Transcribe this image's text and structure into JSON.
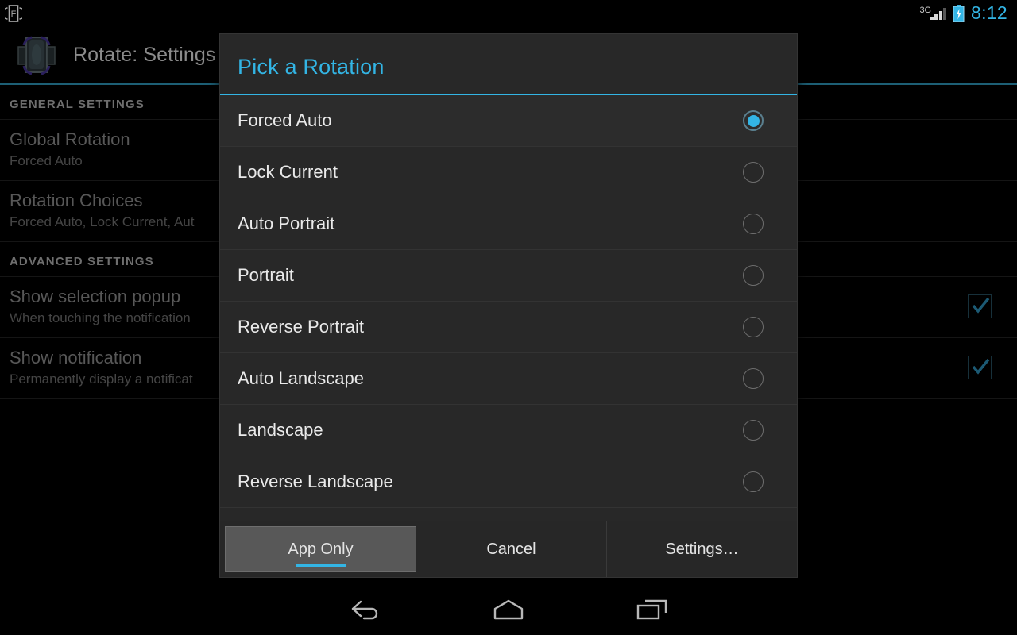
{
  "statusbar": {
    "notification_icon": "rotate-f-icon",
    "signal_label": "3G",
    "signal_icon": "signal-bars-icon",
    "battery_icon": "battery-charging-icon",
    "time": "8:12",
    "time_color": "#33b5e5"
  },
  "app": {
    "icon": "rotate-device-icon",
    "title": "Rotate: Settings",
    "accent_color": "#33b5e5",
    "sections": [
      {
        "header": "GENERAL SETTINGS",
        "rows": [
          {
            "title": "Global Rotation",
            "summary": "Forced Auto",
            "checkbox": null
          },
          {
            "title": "Rotation Choices",
            "summary": "Forced Auto, Lock Current, Aut",
            "checkbox": null
          }
        ]
      },
      {
        "header": "ADVANCED SETTINGS",
        "rows": [
          {
            "title": "Show selection popup",
            "summary": "When touching the notification",
            "checkbox": "checked"
          },
          {
            "title": "Show notification",
            "summary": "Permanently display a notificat",
            "checkbox": "checked"
          }
        ]
      }
    ]
  },
  "dialog": {
    "title": "Pick a Rotation",
    "title_color": "#33b5e5",
    "options": [
      {
        "label": "Forced Auto",
        "selected": true
      },
      {
        "label": "Lock Current",
        "selected": false
      },
      {
        "label": "Auto Portrait",
        "selected": false
      },
      {
        "label": "Portrait",
        "selected": false
      },
      {
        "label": "Reverse Portrait",
        "selected": false
      },
      {
        "label": "Auto Landscape",
        "selected": false
      },
      {
        "label": "Landscape",
        "selected": false
      },
      {
        "label": "Reverse Landscape",
        "selected": false
      }
    ],
    "buttons": [
      {
        "label": "App Only",
        "state": "pressed"
      },
      {
        "label": "Cancel",
        "state": "normal"
      },
      {
        "label": "Settings…",
        "state": "normal"
      }
    ]
  },
  "navbar": {
    "back": "back-icon",
    "home": "home-icon",
    "recents": "recents-icon"
  }
}
